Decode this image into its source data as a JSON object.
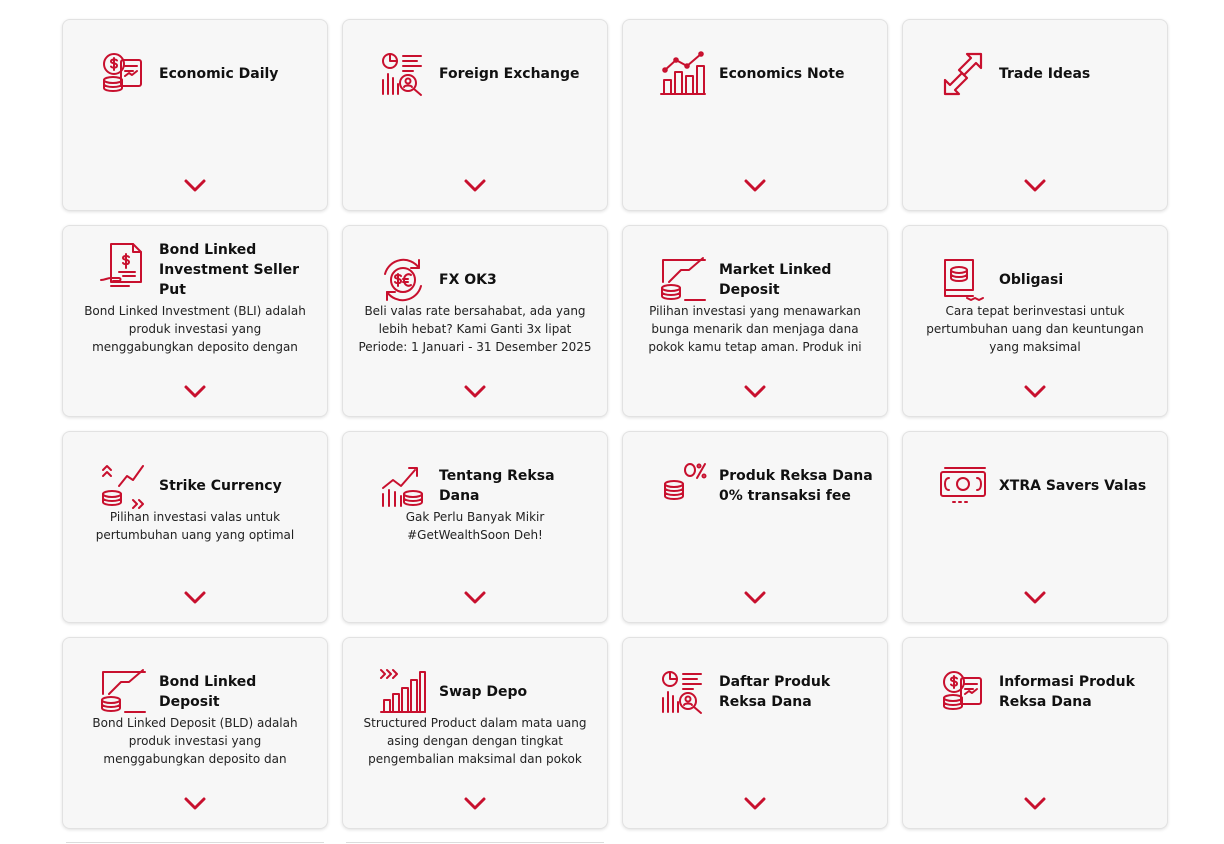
{
  "accent_color": "#c8102e",
  "cards": [
    {
      "title": "Economic Daily",
      "desc": "",
      "icon": "money-report-icon"
    },
    {
      "title": "Foreign Exchange",
      "desc": "",
      "icon": "chart-magnifier-icon"
    },
    {
      "title": "Economics Note",
      "desc": "",
      "icon": "bar-line-chart-icon"
    },
    {
      "title": "Trade Ideas",
      "desc": "",
      "icon": "exchange-arrows-icon"
    },
    {
      "title": "Bond Linked Investment Seller Put",
      "desc": "Bond Linked Investment (BLI) adalah produk investasi yang menggabungkan deposito dengan instrumen keuangan",
      "icon": "bond-document-icon"
    },
    {
      "title": "FX OK3",
      "desc": "Beli valas rate bersahabat, ada yang lebih hebat? Kami Ganti 3x lipat Periode: 1 Januari - 31 Desember 2025",
      "icon": "currency-exchange-icon"
    },
    {
      "title": "Market Linked Deposit",
      "desc": "Pilihan investasi yang menawarkan bunga menarik dan menjaga dana pokok kamu tetap aman. Produk ini",
      "icon": "coins-growth-icon"
    },
    {
      "title": "Obligasi",
      "desc": "Cara tepat berinvestasi untuk pertumbuhan uang dan keuntungan yang maksimal",
      "icon": "bond-coins-icon"
    },
    {
      "title": "Strike Currency",
      "desc": "Pilihan investasi valas untuk pertumbuhan uang yang optimal",
      "icon": "coins-arrows-icon"
    },
    {
      "title": "Tentang Reksa Dana",
      "desc": "Gak Perlu Banyak Mikir #GetWealthSoon Deh!",
      "icon": "chart-coins-icon"
    },
    {
      "title": "Produk Reksa Dana 0% transaksi fee",
      "desc": "",
      "icon": "zero-percent-coins-icon"
    },
    {
      "title": "XTRA Savers Valas",
      "desc": "",
      "icon": "banknote-icon"
    },
    {
      "title": "Bond Linked Deposit",
      "desc": "Bond Linked Deposit (BLD) adalah produk investasi yang menggabungkan deposito dan instrumen keuangan",
      "icon": "coins-growth-icon"
    },
    {
      "title": "Swap Depo",
      "desc": "Structured Product dalam mata uang asing dengan dengan tingkat pengembalian maksimal dan pokok",
      "icon": "bar-chart-arrows-icon"
    },
    {
      "title": "Daftar Produk Reksa Dana",
      "desc": "",
      "icon": "chart-magnifier-icon"
    },
    {
      "title": "Informasi Produk Reksa Dana",
      "desc": "",
      "icon": "money-report-icon"
    }
  ]
}
